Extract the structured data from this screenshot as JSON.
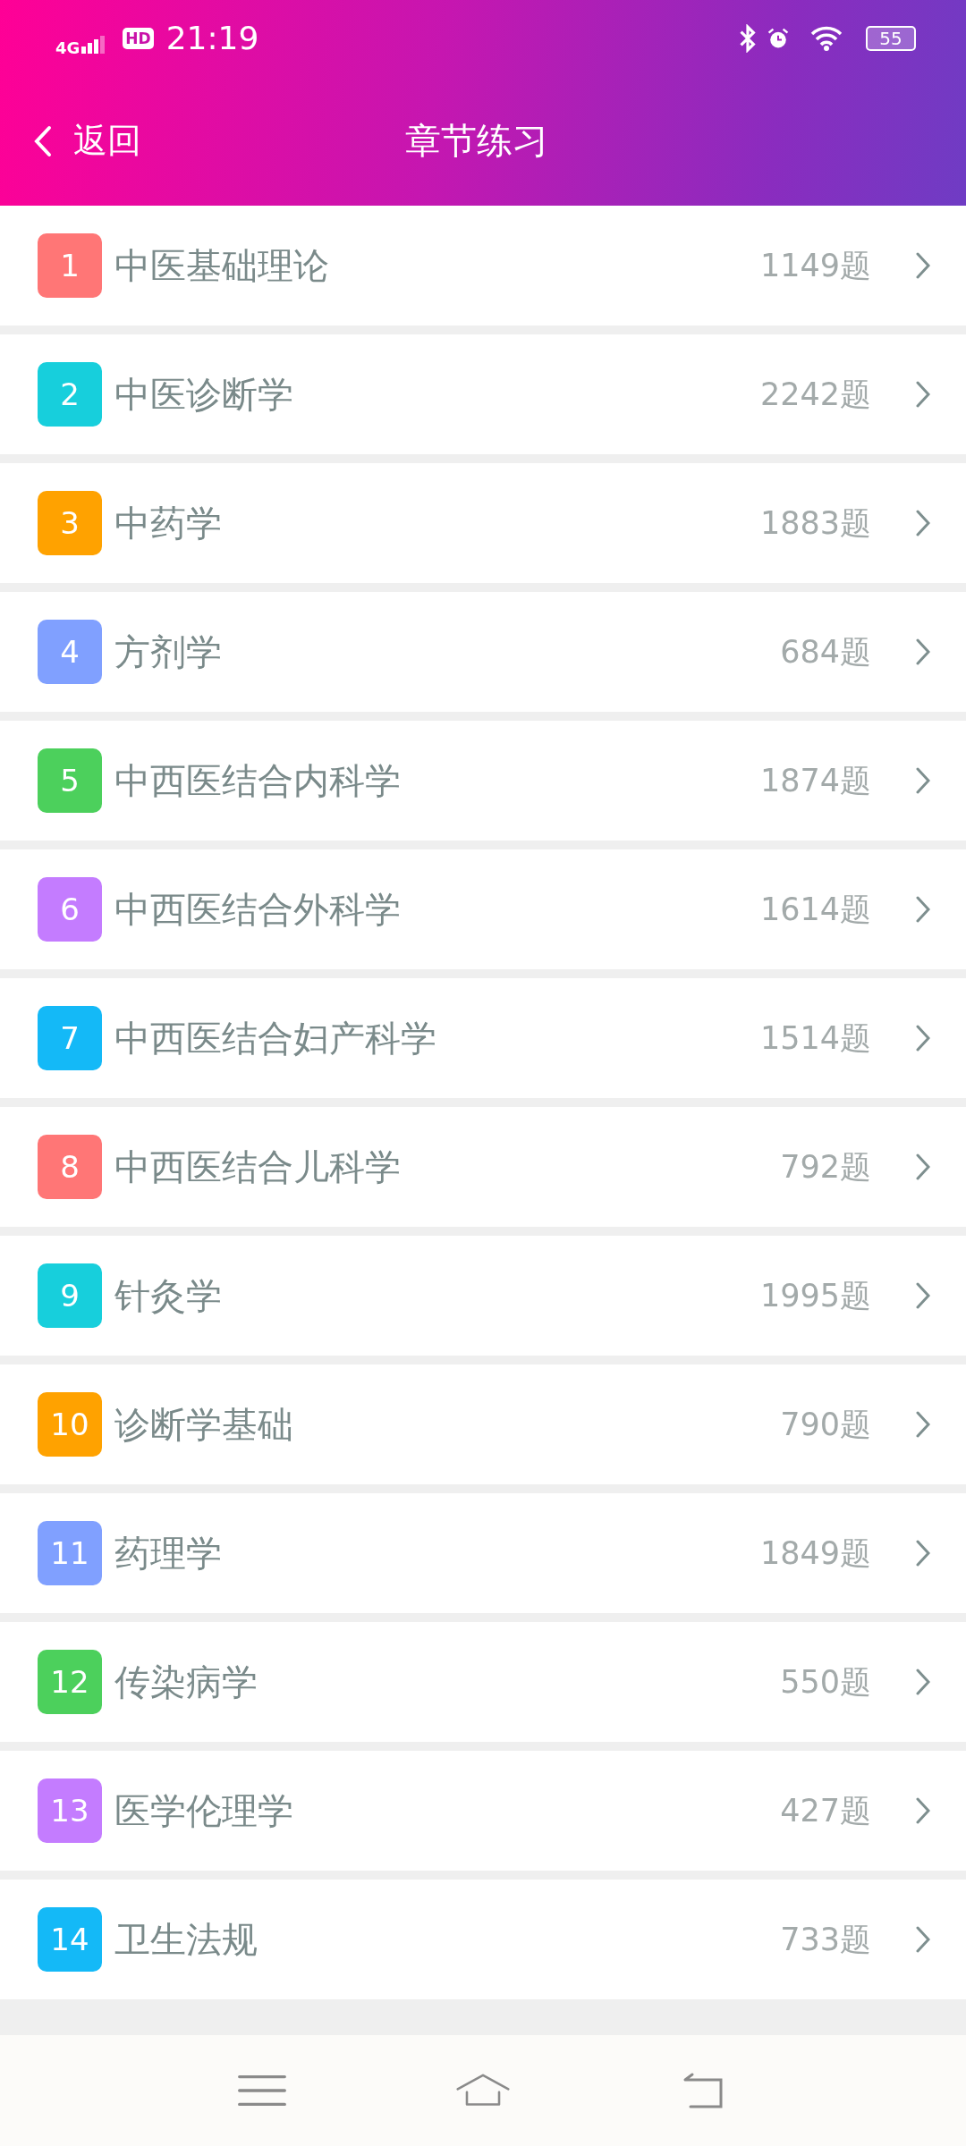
{
  "status_bar": {
    "network": "4G",
    "hd": "HD",
    "time": "21:19",
    "battery": "55"
  },
  "header": {
    "back": "返回",
    "title": "章节练习"
  },
  "chapters": [
    {
      "number": "1",
      "name": "中医基础理论",
      "count": "1149题",
      "color": "#ff7676"
    },
    {
      "number": "2",
      "name": "中医诊断学",
      "count": "2242题",
      "color": "#17cfdc"
    },
    {
      "number": "3",
      "name": "中药学",
      "count": "1883题",
      "color": "#ffa200"
    },
    {
      "number": "4",
      "name": "方剂学",
      "count": "684题",
      "color": "#80a0ff"
    },
    {
      "number": "5",
      "name": "中西医结合内科学",
      "count": "1874题",
      "color": "#4cd05c"
    },
    {
      "number": "6",
      "name": "中西医结合外科学",
      "count": "1614题",
      "color": "#c47cff"
    },
    {
      "number": "7",
      "name": "中西医结合妇产科学",
      "count": "1514题",
      "color": "#14b9f7"
    },
    {
      "number": "8",
      "name": "中西医结合儿科学",
      "count": "792题",
      "color": "#ff7676"
    },
    {
      "number": "9",
      "name": "针灸学",
      "count": "1995题",
      "color": "#17cfdc"
    },
    {
      "number": "10",
      "name": "诊断学基础",
      "count": "790题",
      "color": "#ffa200"
    },
    {
      "number": "11",
      "name": "药理学",
      "count": "1849题",
      "color": "#80a0ff"
    },
    {
      "number": "12",
      "name": "传染病学",
      "count": "550题",
      "color": "#4cd05c"
    },
    {
      "number": "13",
      "name": "医学伦理学",
      "count": "427题",
      "color": "#c47cff"
    },
    {
      "number": "14",
      "name": "卫生法规",
      "count": "733题",
      "color": "#14b9f7"
    }
  ]
}
